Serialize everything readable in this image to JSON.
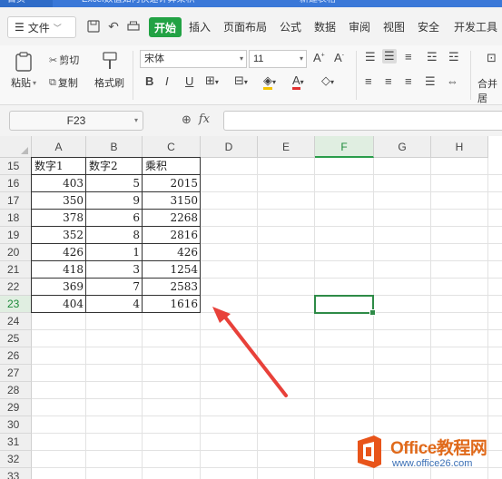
{
  "titlebar": {
    "home_tab": "首页",
    "doc_tab": "Excel数值如何快速计算乘积",
    "doc2_tab": "新建表格"
  },
  "menubar": {
    "file_label": "文件",
    "active_tab": "开始",
    "tabs": [
      "插入",
      "页面布局",
      "公式",
      "数据",
      "审阅",
      "视图",
      "安全",
      "开发工具"
    ]
  },
  "ribbon": {
    "paste": "粘贴",
    "cut": "剪切",
    "copy": "复制",
    "format_painter": "格式刷",
    "font_name": "宋体",
    "font_size": "11",
    "bold": "B",
    "italic": "I",
    "underline": "U",
    "merge_center": "合并居"
  },
  "formula_bar": {
    "name_box": "F23",
    "fx": "fx",
    "formula": ""
  },
  "sheet": {
    "columns": [
      "A",
      "B",
      "C",
      "D",
      "E",
      "F",
      "G",
      "H"
    ],
    "active_column": "F",
    "rows": [
      "15",
      "16",
      "17",
      "18",
      "19",
      "20",
      "21",
      "22",
      "23",
      "24",
      "25",
      "26",
      "27",
      "28",
      "29",
      "30",
      "31",
      "32",
      "33"
    ],
    "active_row": "23",
    "selected_cell": "F23",
    "headers": [
      "数字1",
      "数字2",
      "乘积"
    ],
    "data": [
      [
        "403",
        "5",
        "2015"
      ],
      [
        "350",
        "9",
        "3150"
      ],
      [
        "378",
        "6",
        "2268"
      ],
      [
        "352",
        "8",
        "2816"
      ],
      [
        "426",
        "1",
        "426"
      ],
      [
        "418",
        "3",
        "1254"
      ],
      [
        "369",
        "7",
        "2583"
      ],
      [
        "404",
        "4",
        "1616"
      ]
    ]
  },
  "annotation": {
    "arrow_color": "#e8413a"
  },
  "watermark": {
    "brand": "Office教程网",
    "url": "www.office26.com"
  }
}
